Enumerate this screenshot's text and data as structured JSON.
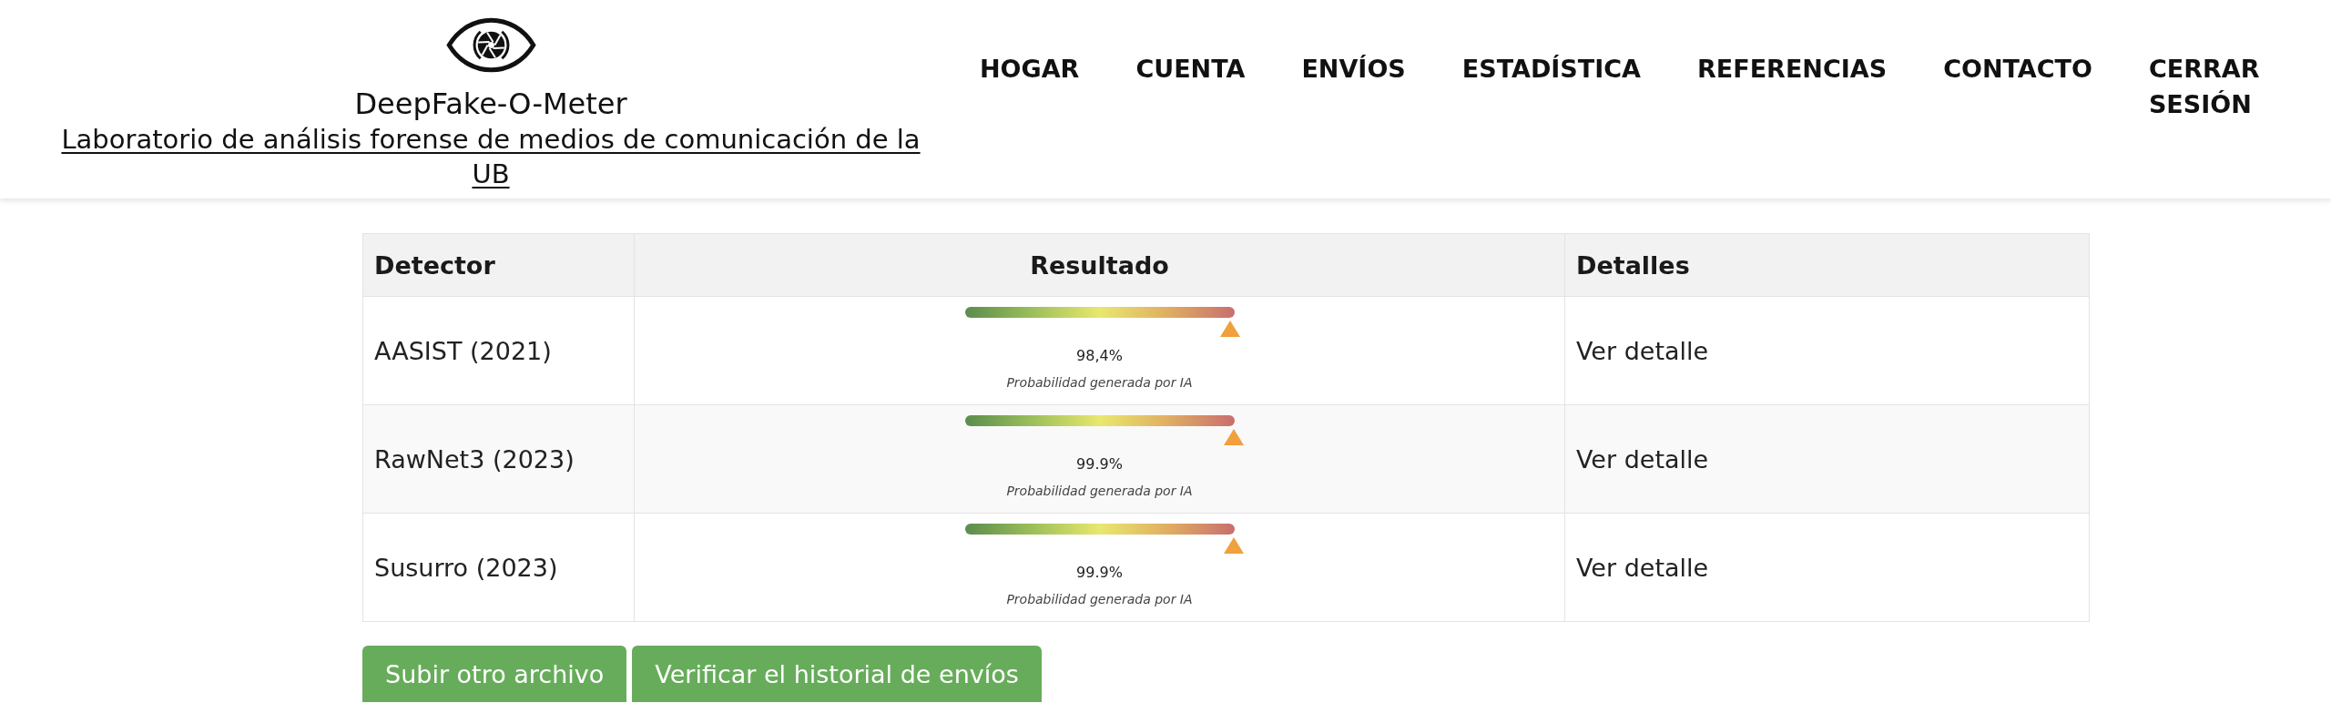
{
  "brand": {
    "title": "DeepFake-O-Meter",
    "subtitle": "Laboratorio de análisis forense de medios de comunicación de la UB"
  },
  "nav": [
    "HOGAR",
    "CUENTA",
    "ENVÍOS",
    "ESTADÍSTICA",
    "REFERENCIAS",
    "CONTACTO",
    "CERRAR SESIÓN"
  ],
  "table": {
    "columns": [
      "Detector",
      "Resultado",
      "Detalles"
    ],
    "rows": [
      {
        "detector": "AASIST (2021)",
        "level": 0.984,
        "reading": "98,4%",
        "caption": "Probabilidad generada por IA",
        "details": "Ver detalle"
      },
      {
        "detector": "RawNet3 (2023)",
        "level": 0.999,
        "reading": "99.9%",
        "caption": "Probabilidad generada por IA",
        "details": "Ver detalle"
      },
      {
        "detector": "Susurro (2023)",
        "level": 0.999,
        "reading": "99.9%",
        "caption": "Probabilidad generada por IA",
        "details": "Ver detalle"
      }
    ]
  },
  "buttons": [
    "Subir otro archivo",
    "Verificar el historial de envíos"
  ]
}
